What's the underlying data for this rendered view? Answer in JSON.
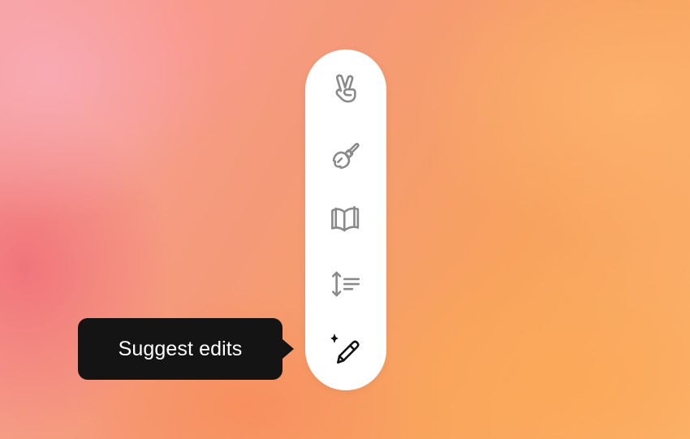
{
  "toolbar": {
    "items": [
      {
        "icon": "victory-hand-icon",
        "state": "inactive"
      },
      {
        "icon": "paintbrush-icon",
        "state": "inactive"
      },
      {
        "icon": "open-book-icon",
        "state": "inactive"
      },
      {
        "icon": "text-length-icon",
        "state": "inactive"
      },
      {
        "icon": "sparkle-pencil-icon",
        "state": "active"
      }
    ]
  },
  "tooltip": {
    "label": "Suggest edits"
  },
  "colors": {
    "toolbar_background": "#ffffff",
    "icon_inactive": "#8a8a8a",
    "icon_active": "#111111",
    "tooltip_background": "#141414",
    "tooltip_text": "#ffffff"
  }
}
